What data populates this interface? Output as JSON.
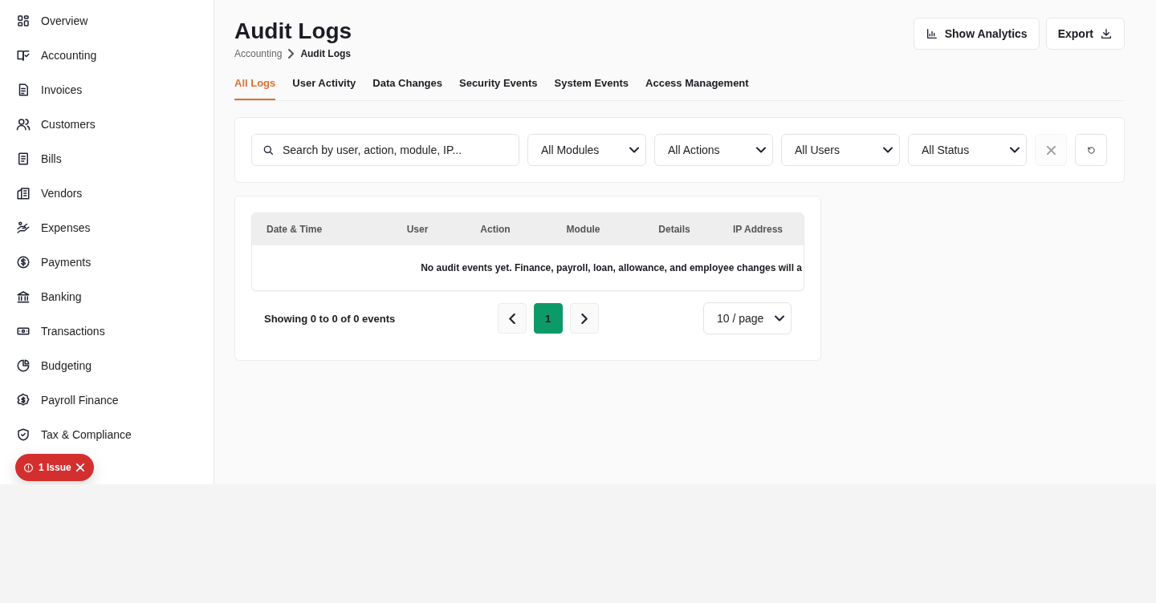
{
  "sidebar": {
    "items": [
      {
        "label": "Overview"
      },
      {
        "label": "Accounting"
      },
      {
        "label": "Invoices"
      },
      {
        "label": "Customers"
      },
      {
        "label": "Bills"
      },
      {
        "label": "Vendors"
      },
      {
        "label": "Expenses"
      },
      {
        "label": "Payments"
      },
      {
        "label": "Banking"
      },
      {
        "label": "Transactions"
      },
      {
        "label": "Budgeting"
      },
      {
        "label": "Payroll Finance"
      },
      {
        "label": "Tax & Compliance"
      }
    ]
  },
  "issue_badge": {
    "label": "1 Issue"
  },
  "header": {
    "title": "Audit Logs",
    "breadcrumb": [
      "Accounting",
      "Audit Logs"
    ],
    "buttons": [
      {
        "label": "Show Analytics"
      },
      {
        "label": "Export"
      }
    ]
  },
  "tabs": [
    {
      "label": "All Logs",
      "selected": true
    },
    {
      "label": "User Activity",
      "selected": false
    },
    {
      "label": "Data Changes",
      "selected": false
    },
    {
      "label": "Security Events",
      "selected": false
    },
    {
      "label": "System Events",
      "selected": false
    },
    {
      "label": "Access Management",
      "selected": false
    }
  ],
  "filters": {
    "search": {
      "placeholder": "Search by user, action, module, IP..."
    },
    "dropdowns": [
      "All Modules",
      "All Actions",
      "All Users",
      "All Status"
    ],
    "clear_disabled": true
  },
  "table": {
    "columns": [
      "Date & Time",
      "User",
      "Action",
      "Module",
      "Details",
      "IP Address"
    ],
    "empty_message": "No audit events yet. Finance, payroll, loan, allowance, and employee changes will a"
  },
  "pagination": {
    "summary": "Showing 0 to 0 of 0 events",
    "pages": [
      {
        "label": "1",
        "selected": true
      }
    ],
    "page_size": "10 / page"
  }
}
